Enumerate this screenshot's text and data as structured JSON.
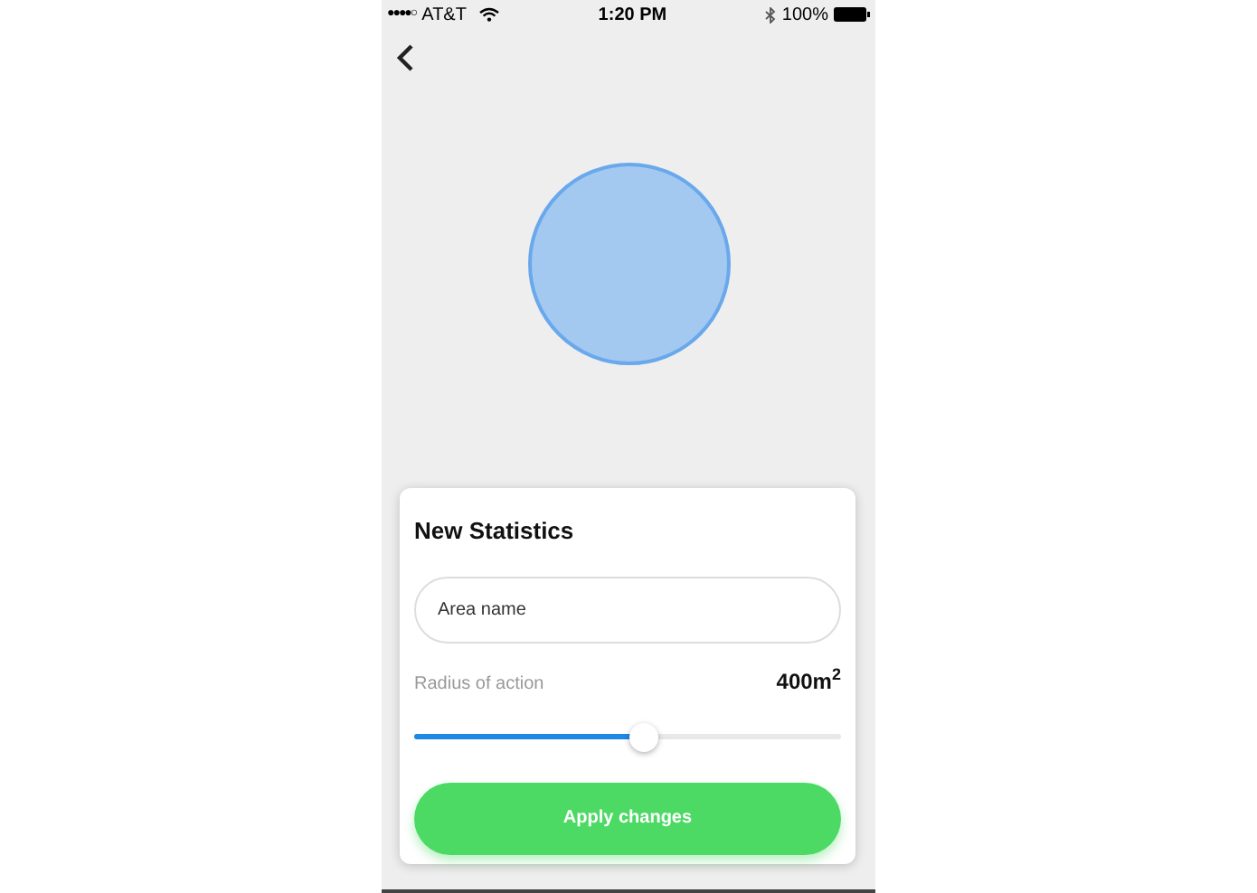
{
  "status_bar": {
    "carrier": "AT&T",
    "signal_dots": "●●●●○",
    "time": "1:20 PM",
    "battery": "100%"
  },
  "panel": {
    "title": "New Statistics",
    "area_field": {
      "placeholder": "Area name"
    },
    "radius": {
      "label": "Radius of action",
      "reading": "400m$^{2}$",
      "level": 0.54
    },
    "apply_button": "Apply changes"
  }
}
